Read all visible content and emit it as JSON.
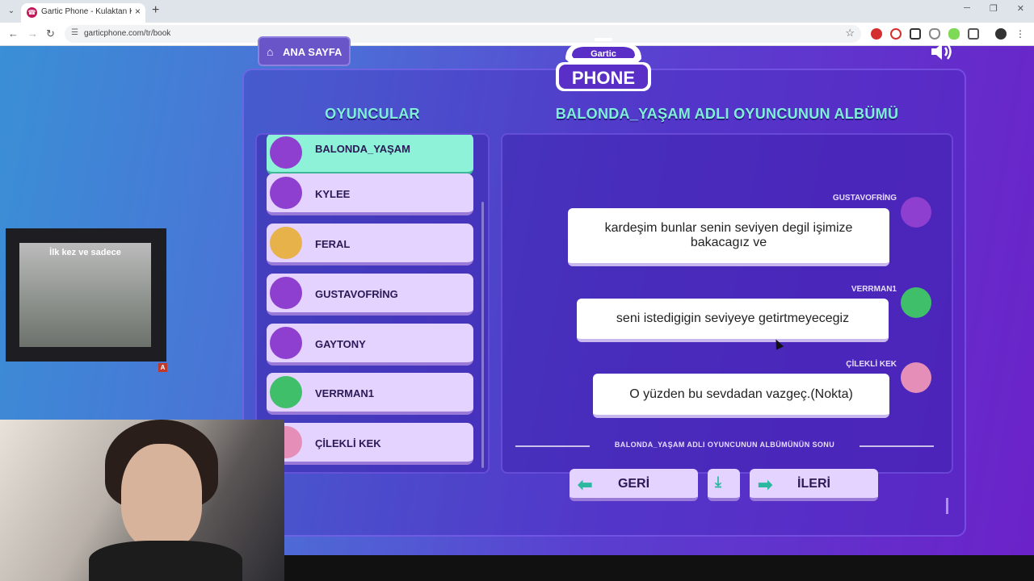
{
  "browser": {
    "tab_title": "Gartic Phone - Kulaktan Kulağa",
    "url": "garticphone.com/tr/book",
    "tab_icon": "phone-icon"
  },
  "game": {
    "home_button": "ANA SAYFA",
    "logo_top": "Gartic",
    "logo_bottom": "PHONE",
    "players_heading": "OYUNCULAR",
    "album_heading": "BALONDA_YAŞAM ADLI OYUNCUNUN ALBÜMÜ",
    "players": [
      {
        "name": "BALONDA_YAŞAM",
        "active": true,
        "avatar": "purple-bird",
        "color": "#8e3fd0"
      },
      {
        "name": "KYLEE",
        "active": false,
        "avatar": "purple-bird",
        "color": "#8e3fd0"
      },
      {
        "name": "FERAL",
        "active": false,
        "avatar": "masked-face",
        "color": "#e8b24a"
      },
      {
        "name": "GUSTAVOFRİNG",
        "active": false,
        "avatar": "purple-bird",
        "color": "#8e3fd0"
      },
      {
        "name": "GAYTONY",
        "active": false,
        "avatar": "purple-bird",
        "color": "#8e3fd0"
      },
      {
        "name": "VERRMAN1",
        "active": false,
        "avatar": "green-monster",
        "color": "#3fbf6a"
      },
      {
        "name": "ÇİLEKLİ KEK",
        "active": false,
        "avatar": "pink-cupcake",
        "color": "#e58fb8"
      }
    ],
    "messages": [
      {
        "author": "GUSTAVOFRİNG",
        "text": "kardeşim bunlar senin seviyen degil işimize bakacagız ve",
        "avatar_color": "#8e3fd0"
      },
      {
        "author": "VERRMAN1",
        "text": "seni istedigigin seviyeye getirtmeyecegiz",
        "avatar_color": "#3fbf6a"
      },
      {
        "author": "ÇİLEKLİ KEK",
        "text": "O yüzden bu sevdadan vazgeç.(Nokta)",
        "avatar_color": "#e58fb8"
      }
    ],
    "album_end": "BALONDA_YAŞAM ADLI OYUNCUNUN ALBÜMÜNÜN SONU",
    "back_button": "GERİ",
    "next_button": "İLERİ",
    "accent": "#7ff0d8"
  },
  "overlay": {
    "video_caption": "İlk kez ve sadece",
    "video_badge": "A"
  }
}
